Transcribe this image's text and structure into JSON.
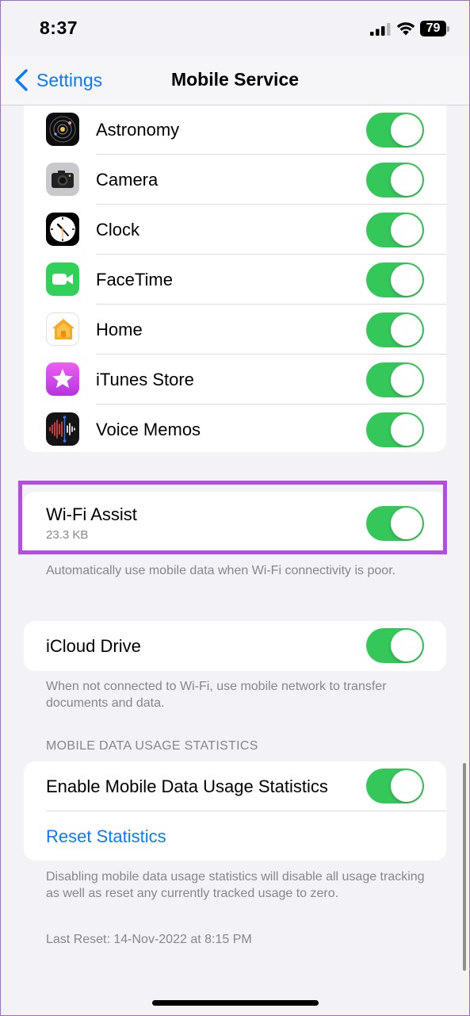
{
  "status_bar": {
    "time": "8:37",
    "battery_level": "79"
  },
  "nav": {
    "back_label": "Settings",
    "title": "Mobile Service"
  },
  "apps": [
    {
      "name": "Astronomy",
      "icon": "astronomy-icon",
      "enabled": true
    },
    {
      "name": "Camera",
      "icon": "camera-icon",
      "enabled": true
    },
    {
      "name": "Clock",
      "icon": "clock-icon",
      "enabled": true
    },
    {
      "name": "FaceTime",
      "icon": "facetime-icon",
      "enabled": true
    },
    {
      "name": "Home",
      "icon": "home-icon",
      "enabled": true
    },
    {
      "name": "iTunes Store",
      "icon": "itunes-store-icon",
      "enabled": true
    },
    {
      "name": "Voice Memos",
      "icon": "voice-memos-icon",
      "enabled": true
    }
  ],
  "wifi_assist": {
    "label": "Wi-Fi Assist",
    "usage": "23.3 KB",
    "enabled": true,
    "footnote": "Automatically use mobile data when Wi-Fi connectivity is poor."
  },
  "icloud_drive": {
    "label": "iCloud Drive",
    "enabled": true,
    "footnote": "When not connected to Wi-Fi, use mobile network to transfer documents and data."
  },
  "statistics": {
    "header": "MOBILE DATA USAGE STATISTICS",
    "enable_label": "Enable Mobile Data Usage Statistics",
    "enabled": true,
    "reset_label": "Reset Statistics",
    "footnote": "Disabling mobile data usage statistics will disable all usage tracking as well as reset any currently tracked usage to zero.",
    "last_reset": "Last Reset: 14-Nov-2022 at 8:15 PM"
  },
  "colors": {
    "accent": "#0a7aff",
    "toggle_on": "#34c759",
    "highlight": "#b44ce6"
  }
}
